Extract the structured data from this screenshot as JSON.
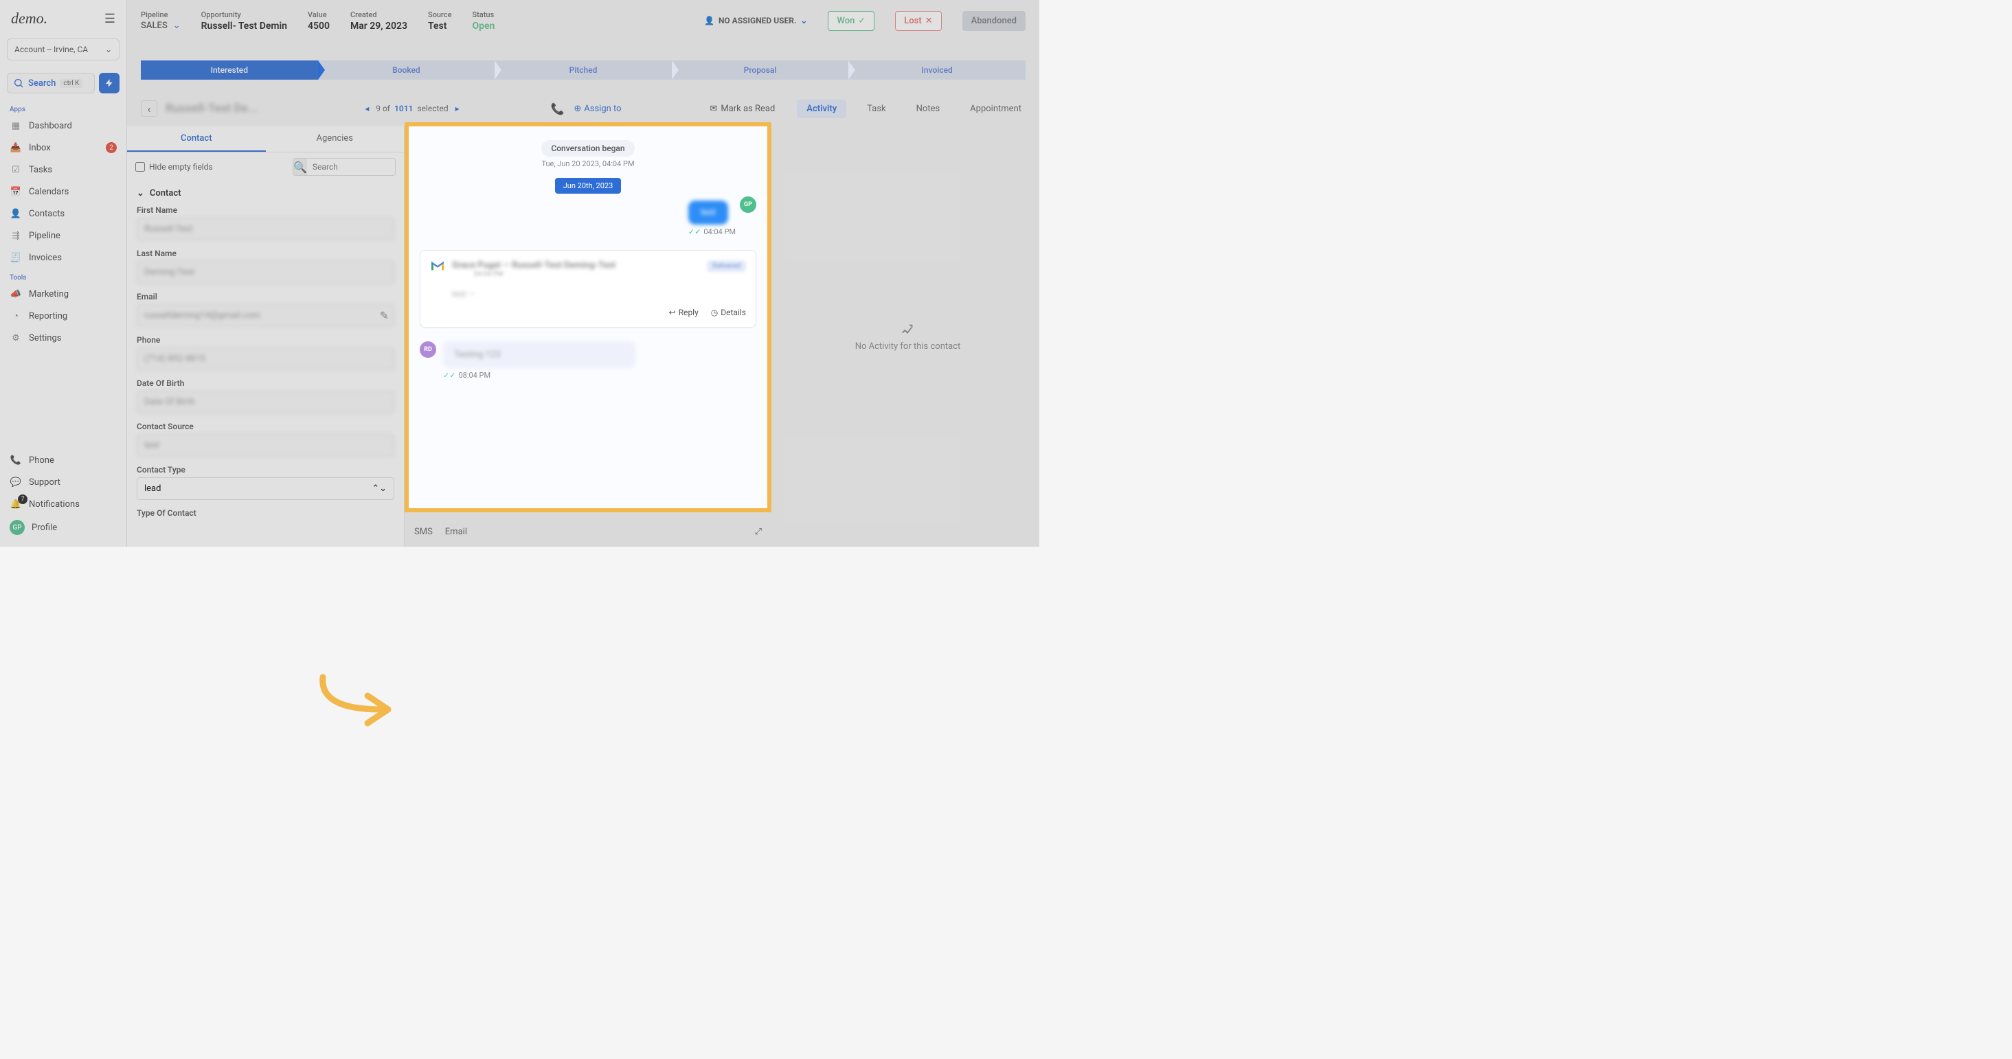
{
  "sidebar": {
    "logo": "demo.",
    "account": "Account -- Irvine, CA",
    "search": "Search",
    "shortcut": "ctrl K",
    "apps_heading": "Apps",
    "tools_heading": "Tools",
    "nav": {
      "dashboard": "Dashboard",
      "inbox": "Inbox",
      "inbox_badge": "2",
      "tasks": "Tasks",
      "calendars": "Calendars",
      "contacts": "Contacts",
      "pipeline": "Pipeline",
      "invoices": "Invoices",
      "marketing": "Marketing",
      "reporting": "Reporting",
      "settings": "Settings"
    },
    "bottom": {
      "phone": "Phone",
      "support": "Support",
      "notifications": "Notifications",
      "notif_badge": "7",
      "profile": "Profile",
      "profile_initials": "GP"
    }
  },
  "header": {
    "pipeline_label": "Pipeline",
    "pipeline_value": "SALES",
    "opportunity_label": "Opportunity",
    "opportunity_value": "Russell- Test Demin",
    "value_label": "Value",
    "value_value": "4500",
    "created_label": "Created",
    "created_value": "Mar 29, 2023",
    "source_label": "Source",
    "source_value": "Test",
    "status_label": "Status",
    "status_value": "Open",
    "assigned_user": "NO ASSIGNED USER.",
    "won": "Won",
    "lost": "Lost",
    "abandoned": "Abandoned"
  },
  "stages": [
    "Interested",
    "Booked",
    "Pitched",
    "Proposal",
    "Invoiced"
  ],
  "subheader": {
    "contact_name": "Russell-Test De...",
    "pager_pos": "9 of",
    "pager_total": "1011",
    "pager_sel": "selected",
    "assign_to": "Assign to",
    "mark_read": "Mark as Read",
    "tabs": {
      "activity": "Activity",
      "task": "Task",
      "notes": "Notes",
      "appointment": "Appointment"
    }
  },
  "left_panel": {
    "tabs": {
      "contact": "Contact",
      "agencies": "Agencies"
    },
    "hide_empty": "Hide empty fields",
    "search_placeholder": "Search",
    "section": "Contact",
    "fields": {
      "first_name": {
        "label": "First Name",
        "value": "Russell-Test"
      },
      "last_name": {
        "label": "Last Name",
        "value": "Deming-Test"
      },
      "email": {
        "label": "Email",
        "value": "russelldeming14@gmail.com"
      },
      "phone": {
        "label": "Phone",
        "value": "(714) 892-4815"
      },
      "dob": {
        "label": "Date Of Birth",
        "value": "Date Of Birth"
      },
      "contact_source": {
        "label": "Contact Source",
        "value": "test"
      },
      "contact_type": {
        "label": "Contact Type",
        "value": "lead"
      },
      "type_of_contact": {
        "label": "Type Of Contact"
      }
    }
  },
  "conversation": {
    "began": "Conversation began",
    "began_date": "Tue, Jun 20 2023, 04:04 PM",
    "date_pill": "Jun 20th, 2023",
    "out_msg": "test",
    "out_time": "04:04 PM",
    "out_avatar": "GP",
    "email_subject": "Grace Pugel — Russell-Test Deming-Test",
    "email_meta": "04:04 PM",
    "email_status": "Delivered",
    "email_body": "test\n—",
    "reply": "Reply",
    "details": "Details",
    "in_avatar": "RD",
    "in_msg": "Testing 123",
    "in_time": "08:04 PM"
  },
  "compose": {
    "sms": "SMS",
    "email": "Email"
  },
  "activity": {
    "empty": "No Activity for this contact"
  }
}
